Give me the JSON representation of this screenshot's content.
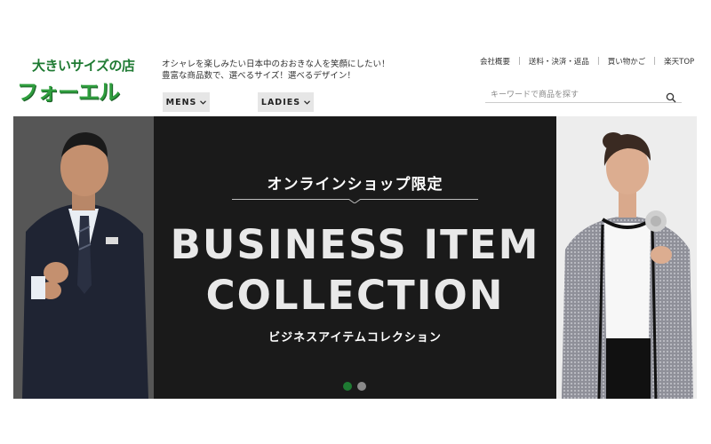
{
  "logo": {
    "line1": "大きいサイズの店",
    "line2": "フォーエル"
  },
  "tagline": {
    "line1": "オシャレを楽しみたい日本中のおおきな人を笑顔にしたい！",
    "line2": "豊富な商品数で、選べるサイズ！選べるデザイン！"
  },
  "nav": {
    "mens": "MENS",
    "ladies": "LADIES"
  },
  "top_links": [
    "会社概要",
    "送料・決済・返品",
    "買い物かご",
    "楽天TOP"
  ],
  "search": {
    "placeholder": "キーワードで商品を探す",
    "value": ""
  },
  "hero": {
    "kicker": "オンラインショップ限定",
    "headline_1": "BUSINESS ITEM",
    "headline_2": "COLLECTION",
    "subtitle": "ビジネスアイテムコレクション",
    "slide_count": 2,
    "active_slide": 1
  },
  "colors": {
    "brand_green": "#1e7a32",
    "logo_green": "#2f9e3e",
    "hero_bg": "#1a1a1a",
    "nav_bg": "#e6e6e6"
  },
  "icons": {
    "search": "search-icon",
    "chevron": "chevron-down-icon"
  }
}
